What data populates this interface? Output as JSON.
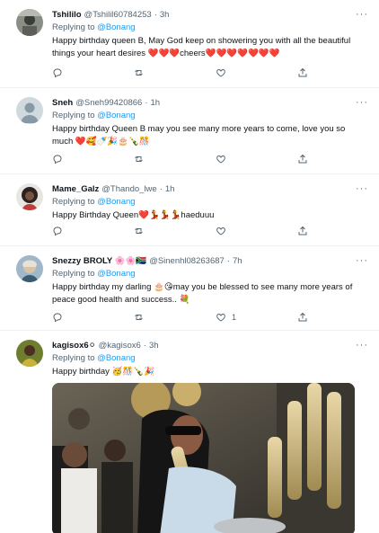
{
  "reply_prefix": "Replying to",
  "tweets": [
    {
      "name": "Tshililo",
      "handle": "@Tshilil60784253",
      "time": "3h",
      "mention": "@Bonang",
      "text": "Happy birthday queen B, May God keep on showering you with all the beautiful things your heart desires ❤️❤️❤️cheers❤️❤️❤️❤️❤️❤️❤️",
      "like_count": ""
    },
    {
      "name": "Sneh",
      "handle": "@Sneh99420866",
      "time": "1h",
      "mention": "@Bonang",
      "text": "Happy birthday Queen B may you see many more years to come, love you so much ❤️🥰🍼🎉🎂🍾🎊",
      "like_count": ""
    },
    {
      "name": "Mame_Galz",
      "handle": "@Thando_lwe",
      "time": "1h",
      "mention": "@Bonang",
      "text": "Happy Birthday Queen❤️💃💃💃haeduuu",
      "like_count": ""
    },
    {
      "name": "Snezzy BROLY 🌸🌸🇿🇦",
      "handle": "@Sinenhl08263687",
      "time": "7h",
      "mention": "@Bonang",
      "text": "Happy birthday my darling 🎂😘may you be blessed to see many more years of peace good health and success.. 💐",
      "like_count": "1"
    },
    {
      "name": "kagisox6⚪",
      "handle": "@kagisox6",
      "time": "3h",
      "mention": "@Bonang",
      "text": "Happy birthday 🥳🎊🍾🎉",
      "like_count": ""
    }
  ],
  "colors": {
    "accent": "#1d9bf0",
    "muted": "#536471",
    "divider": "#eff3f4"
  }
}
